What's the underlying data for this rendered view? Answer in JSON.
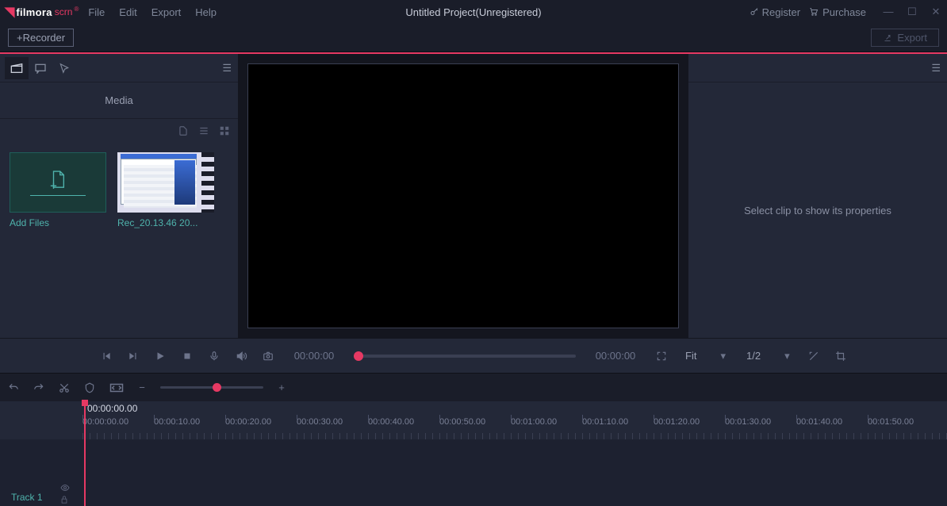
{
  "brand": {
    "name": "filmora",
    "suffix": "scrn",
    "reg": "®"
  },
  "menu": {
    "file": "File",
    "edit": "Edit",
    "export": "Export",
    "help": "Help"
  },
  "title": "Untitled Project(Unregistered)",
  "topright": {
    "register": "Register",
    "purchase": "Purchase"
  },
  "toolbar": {
    "recorder": "+Recorder",
    "export": "Export"
  },
  "media": {
    "header": "Media",
    "add_label": "Add Files",
    "clip_label": "Rec_20.13.46 20..."
  },
  "properties": {
    "placeholder": "Select clip to show its properties"
  },
  "playback": {
    "time_current": "00:00:00",
    "time_total": "00:00:00",
    "fit_label": "Fit",
    "quality_label": "1/2"
  },
  "timeline": {
    "playhead": "00:00:00.00",
    "ticks": [
      "00:00:00.00",
      "00:00:10.00",
      "00:00:20.00",
      "00:00:30.00",
      "00:00:40.00",
      "00:00:50.00",
      "00:01:00.00",
      "00:01:10.00",
      "00:01:20.00",
      "00:01:30.00",
      "00:01:40.00",
      "00:01:50.00"
    ],
    "track1": "Track 1"
  }
}
